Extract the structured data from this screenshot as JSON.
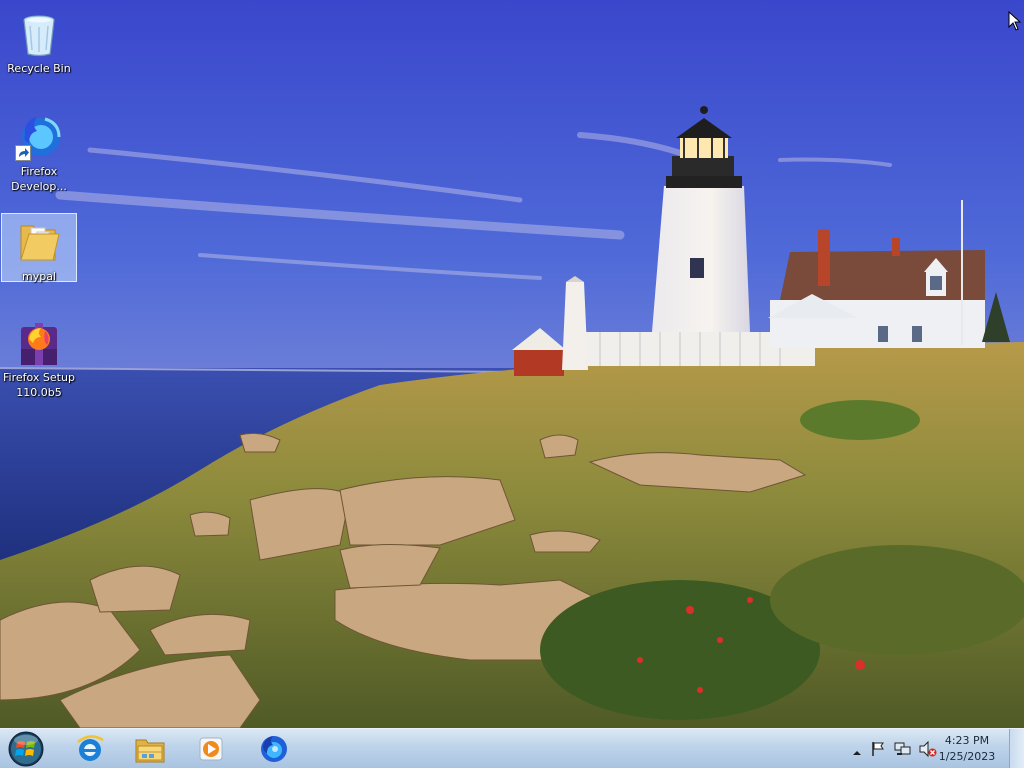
{
  "desktop": {
    "icons": [
      {
        "label_lines": [
          "Recycle Bin"
        ],
        "icon": "recycle-bin-icon",
        "selected": false
      },
      {
        "label_lines": [
          "Firefox",
          "Develop..."
        ],
        "icon": "firefox-developer-icon",
        "shortcut": true,
        "selected": false
      },
      {
        "label_lines": [
          "mypal"
        ],
        "icon": "folder-icon",
        "selected": true
      },
      {
        "label_lines": [
          "Firefox Setup",
          "110.0b5"
        ],
        "icon": "firefox-setup-icon",
        "selected": false
      }
    ]
  },
  "taskbar": {
    "start": "start-orb-icon",
    "pinned": [
      "internet-explorer-icon",
      "file-explorer-icon",
      "media-player-icon",
      "firefox-icon"
    ],
    "tray": {
      "icons": [
        "show-hidden-icons-chevron",
        "action-center-flag-icon",
        "network-icon",
        "volume-muted-icon"
      ],
      "time": "4:23 PM",
      "date": "1/25/2023"
    }
  },
  "colors": {
    "sky_top": "#3b4fd0",
    "sea": "#2a3e9a",
    "grass": "#8a8a3a",
    "taskbar": "#bdd3ea",
    "selection": "#c8deff"
  }
}
